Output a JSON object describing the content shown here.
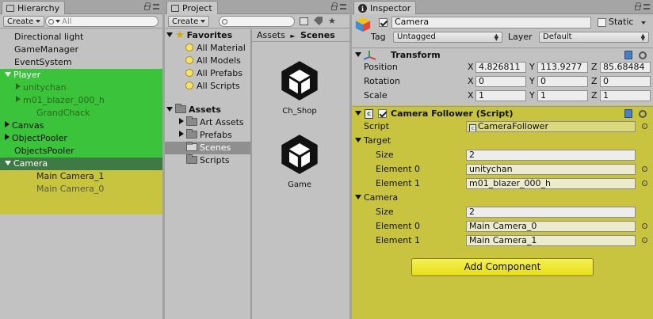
{
  "colors": {
    "selection_green": "#3bc43b",
    "selection_dark_green": "#3e7a44",
    "yellow_tint": "#c9c43f",
    "panel_gray": "#c2c2c2"
  },
  "hierarchy": {
    "tab_label": "Hierarchy",
    "create_label": "Create",
    "search_placeholder": "All",
    "items": [
      {
        "label": "Directional light",
        "indent": 0,
        "arrow": ""
      },
      {
        "label": "GameManager",
        "indent": 0,
        "arrow": ""
      },
      {
        "label": "EventSystem",
        "indent": 0,
        "arrow": ""
      },
      {
        "label": "Player",
        "indent": 0,
        "arrow": "down"
      },
      {
        "label": "unitychan",
        "indent": 1,
        "arrow": "right"
      },
      {
        "label": "m01_blazer_000_h",
        "indent": 1,
        "arrow": "right"
      },
      {
        "label": "GrandChack",
        "indent": 2,
        "arrow": ""
      },
      {
        "label": "Canvas",
        "indent": 0,
        "arrow": "right"
      },
      {
        "label": "ObjectPooler",
        "indent": 0,
        "arrow": "right"
      },
      {
        "label": "ObjectsPooler",
        "indent": 0,
        "arrow": ""
      },
      {
        "label": "Camera",
        "indent": 0,
        "arrow": "down"
      },
      {
        "label": "Main Camera_1",
        "indent": 2,
        "arrow": ""
      },
      {
        "label": "Main Camera_0",
        "indent": 2,
        "arrow": ""
      }
    ]
  },
  "project": {
    "tab_label": "Project",
    "create_label": "Create",
    "favorites_label": "Favorites",
    "favorites": [
      "All Material",
      "All Models",
      "All Prefabs",
      "All Scripts"
    ],
    "assets_label": "Assets",
    "folders": [
      "Art Assets",
      "Prefabs",
      "Scenes",
      "Scripts"
    ],
    "breadcrumb": {
      "root": "Assets",
      "separator": "►",
      "current": "Scenes"
    },
    "scenes": [
      "Ch_Shop",
      "Game"
    ]
  },
  "inspector": {
    "tab_label": "Inspector",
    "object_name": "Camera",
    "static_label": "Static",
    "tag_label": "Tag",
    "tag_value": "Untagged",
    "layer_label": "Layer",
    "layer_value": "Default",
    "transform": {
      "title": "Transform",
      "position_label": "Position",
      "rotation_label": "Rotation",
      "scale_label": "Scale",
      "axis_x": "X",
      "axis_y": "Y",
      "axis_z": "Z",
      "position": {
        "x": "4.826811",
        "y": "113.9277",
        "z": "85.68484"
      },
      "rotation": {
        "x": "0",
        "y": "0",
        "z": "0"
      },
      "scale": {
        "x": "1",
        "y": "1",
        "z": "1"
      }
    },
    "follower": {
      "title": "Camera Follower (Script)",
      "script_label": "Script",
      "script_value": "CameraFollower",
      "target_label": "Target",
      "target_size_label": "Size",
      "target_size": "2",
      "target_elements": [
        {
          "label": "Element 0",
          "value": "unitychan"
        },
        {
          "label": "Element 1",
          "value": "m01_blazer_000_h"
        }
      ],
      "camera_label": "Camera",
      "camera_size_label": "Size",
      "camera_size": "2",
      "camera_elements": [
        {
          "label": "Element 0",
          "value": "Main Camera_0"
        },
        {
          "label": "Element 1",
          "value": "Main Camera_1"
        }
      ]
    },
    "add_component_label": "Add Component"
  }
}
